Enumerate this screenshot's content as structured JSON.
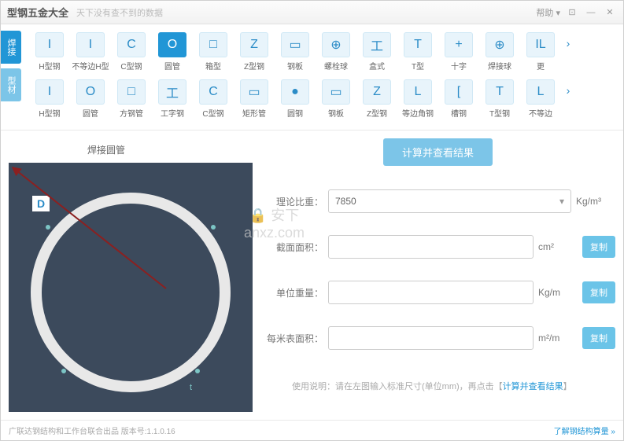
{
  "window": {
    "title": "型钢五金大全",
    "subtitle": "天下没有查不到的数据",
    "help": "帮助 ▾"
  },
  "tabs": {
    "r1": "焊接",
    "r2": "型材"
  },
  "row1": [
    {
      "id": "h-beam",
      "label": "H型钢",
      "glyph": "I"
    },
    {
      "id": "uneq-h",
      "label": "不等边H型",
      "glyph": "I"
    },
    {
      "id": "c-beam",
      "label": "C型钢",
      "glyph": "C"
    },
    {
      "id": "pipe",
      "label": "圆管",
      "glyph": "O",
      "selected": true
    },
    {
      "id": "box",
      "label": "箱型",
      "glyph": "□"
    },
    {
      "id": "z-beam",
      "label": "Z型钢",
      "glyph": "Z"
    },
    {
      "id": "plate",
      "label": "钢板",
      "glyph": "▭"
    },
    {
      "id": "bolt-ball",
      "label": "螺栓球",
      "glyph": "⊕"
    },
    {
      "id": "box2",
      "label": "盒式",
      "glyph": "工"
    },
    {
      "id": "t-shape",
      "label": "T型",
      "glyph": "T"
    },
    {
      "id": "cross",
      "label": "十字",
      "glyph": "+"
    },
    {
      "id": "weld-ball",
      "label": "焊接球",
      "glyph": "⊕"
    },
    {
      "id": "more1",
      "label": "更",
      "glyph": "IL"
    }
  ],
  "row2": [
    {
      "id": "h-beam2",
      "label": "H型钢",
      "glyph": "I"
    },
    {
      "id": "round-pipe",
      "label": "圆管",
      "glyph": "O"
    },
    {
      "id": "sq-pipe",
      "label": "方钢管",
      "glyph": "□"
    },
    {
      "id": "i-beam",
      "label": "工字钢",
      "glyph": "工"
    },
    {
      "id": "c-beam2",
      "label": "C型钢",
      "glyph": "C"
    },
    {
      "id": "rect-pipe",
      "label": "矩形管",
      "glyph": "▭"
    },
    {
      "id": "round-steel",
      "label": "圆钢",
      "glyph": "●"
    },
    {
      "id": "plate2",
      "label": "钢板",
      "glyph": "▭"
    },
    {
      "id": "z-beam2",
      "label": "Z型钢",
      "glyph": "Z"
    },
    {
      "id": "eq-angle",
      "label": "等边角钢",
      "glyph": "L"
    },
    {
      "id": "channel",
      "label": "槽钢",
      "glyph": "["
    },
    {
      "id": "t-beam",
      "label": "T型钢",
      "glyph": "T"
    },
    {
      "id": "uneq",
      "label": "不等边",
      "glyph": "L"
    }
  ],
  "diagram": {
    "title": "焊接圆管",
    "dim_d": "D",
    "dim_t": "t"
  },
  "form": {
    "calc_btn": "计算并查看结果",
    "density_label": "理论比重：",
    "density_value": "7850",
    "density_unit": "Kg/m³",
    "area_label": "截面面积：",
    "area_unit": "cm²",
    "weight_label": "单位重量：",
    "weight_unit": "Kg/m",
    "surface_label": "每米表面积：",
    "surface_unit": "m²/m",
    "copy": "复制",
    "hint_prefix": "使用说明：请在左图输入标准尺寸(单位mm)，再点击【",
    "hint_link": "计算并查看结果",
    "hint_suffix": "】"
  },
  "status": {
    "left": "广联达钢结构和工作台联合出品    版本号:1.1.0.16",
    "right": "了解钢结构算量 »"
  },
  "watermark": {
    "line1": "安下",
    "line2": "anxz.com"
  }
}
